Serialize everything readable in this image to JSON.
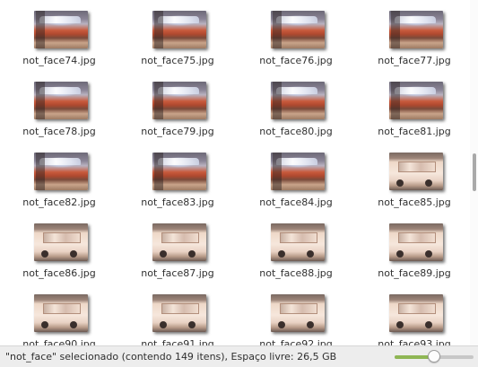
{
  "files": [
    {
      "name": "not_face74.jpg",
      "thumb": "taxi"
    },
    {
      "name": "not_face75.jpg",
      "thumb": "taxi"
    },
    {
      "name": "not_face76.jpg",
      "thumb": "taxi"
    },
    {
      "name": "not_face77.jpg",
      "thumb": "taxi"
    },
    {
      "name": "not_face78.jpg",
      "thumb": "taxi"
    },
    {
      "name": "not_face79.jpg",
      "thumb": "taxi"
    },
    {
      "name": "not_face80.jpg",
      "thumb": "taxi"
    },
    {
      "name": "not_face81.jpg",
      "thumb": "taxi"
    },
    {
      "name": "not_face82.jpg",
      "thumb": "taxi"
    },
    {
      "name": "not_face83.jpg",
      "thumb": "taxi"
    },
    {
      "name": "not_face84.jpg",
      "thumb": "taxi"
    },
    {
      "name": "not_face85.jpg",
      "thumb": "car"
    },
    {
      "name": "not_face86.jpg",
      "thumb": "car"
    },
    {
      "name": "not_face87.jpg",
      "thumb": "car"
    },
    {
      "name": "not_face88.jpg",
      "thumb": "car"
    },
    {
      "name": "not_face89.jpg",
      "thumb": "car"
    },
    {
      "name": "not_face90.jpg",
      "thumb": "car"
    },
    {
      "name": "not_face91.jpg",
      "thumb": "car"
    },
    {
      "name": "not_face92.jpg",
      "thumb": "car"
    },
    {
      "name": "not_face93.jpg",
      "thumb": "car"
    }
  ],
  "statusbar": {
    "text": "\"not_face\" selecionado (contendo 149 itens), Espaço livre: 26,5 GB",
    "zoom_level": 0.5
  },
  "colors": {
    "zoom_accent": "#8fb654"
  }
}
